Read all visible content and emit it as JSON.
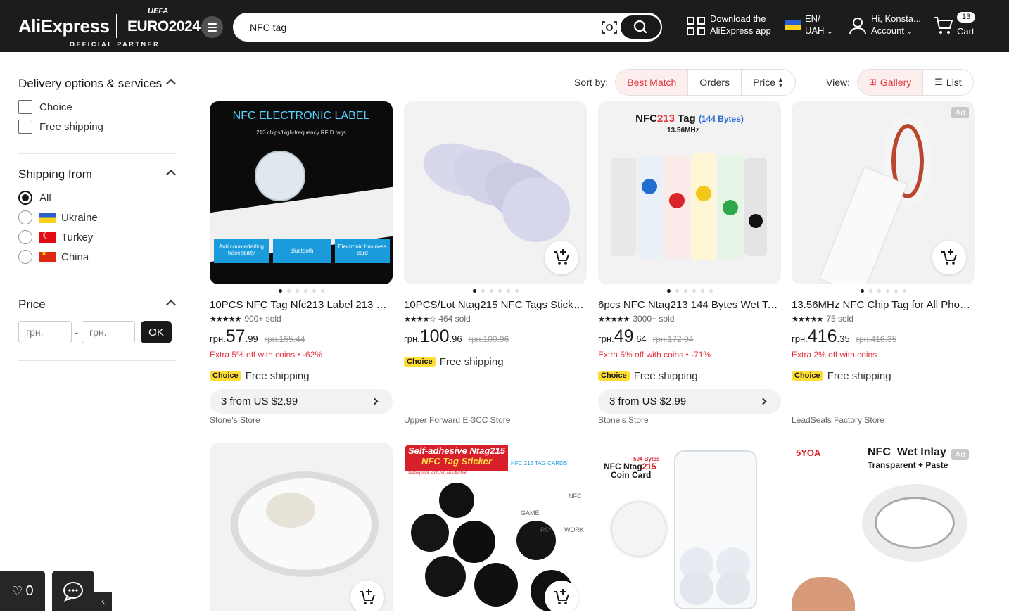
{
  "header": {
    "logo": "AliExpress",
    "euro_top": "UEFA",
    "euro": "EURO2024",
    "partner": "OFFICIAL PARTNER",
    "search_value": "NFC tag",
    "download_line1": "Download the",
    "download_line2": "AliExpress app",
    "lang_line1": "EN/",
    "lang_line2": "UAH",
    "account_line1": "Hi, Konsta...",
    "account_line2": "Account",
    "cart_count": "13",
    "cart_label": "Cart"
  },
  "sidebar": {
    "delivery_title": "Delivery options & services",
    "delivery_options": [
      "Choice",
      "Free shipping"
    ],
    "shipping_title": "Shipping from",
    "shipping_options": [
      "All",
      "Ukraine",
      "Turkey",
      "China"
    ],
    "price_title": "Price",
    "price_min_placeholder": "грн.",
    "price_max_placeholder": "грн.",
    "price_ok": "OK"
  },
  "sort": {
    "label": "Sort by:",
    "options": [
      "Best Match",
      "Orders",
      "Price"
    ],
    "active": "Best Match"
  },
  "view": {
    "label": "View:",
    "options": [
      "Gallery",
      "List"
    ],
    "active": "Gallery"
  },
  "products": [
    {
      "title": "10PCS NFC Tag Nfc213 Label 213 Sticker...",
      "sold": "900+ sold",
      "currency": "грн.",
      "price_int": "57",
      "price_dec": ".99",
      "old_price": "грн.155.44",
      "extra": "Extra 5% off with coins • -62%",
      "choice": "Choice",
      "shipping": "Free shipping",
      "bundle": "3 from US $2.99",
      "store": "Stone's Store",
      "img_title": "NFC ELECTRONIC LABEL",
      "img_sub": "213 chips/high-frequency RFID tags",
      "img_tags": [
        "Anti counterfeiting traceability",
        "bluetooth",
        "Electronic business card"
      ]
    },
    {
      "title": "10PCS/Lot Ntag215 NFC Tags Sticker P...",
      "sold": "464 sold",
      "currency": "грн.",
      "price_int": "100",
      "price_dec": ".96",
      "old_price": "грн.100.96",
      "choice": "Choice",
      "shipping": "Free shipping",
      "store": "Upper Forward E-3CC Store"
    },
    {
      "title": "6pcs NFC Ntag213 144 Bytes Wet Tag ...",
      "sold": "3000+ sold",
      "currency": "грн.",
      "price_int": "49",
      "price_dec": ".64",
      "old_price": "грн.172.94",
      "extra": "Extra 5% off with coins • -71%",
      "choice": "Choice",
      "shipping": "Free shipping",
      "bundle": "3 from US $2.99",
      "store": "Stone's Store",
      "img_title_a": "NFC",
      "img_title_b": "213",
      "img_title_c": " Tag ",
      "img_title_d": "(144 Bytes)",
      "img_sub": "13.56MHz"
    },
    {
      "title": "13.56MHz NFC Chip Tag for All Phone ...",
      "sold": "75 sold",
      "currency": "грн.",
      "price_int": "416",
      "price_dec": ".35",
      "old_price": "грн.416.35",
      "extra": "Extra 2% off with coins",
      "choice": "Choice",
      "shipping": "Free shipping",
      "store": "LeadSeals Factory Store",
      "ad": "Ad"
    }
  ],
  "row2": {
    "p6_banner1": "Self-adhesive Ntag215",
    "p6_banner2": "NFC Tag Sticker",
    "p6_banner3": "Waterproof, Anti-oil, Anti-friction",
    "p6_cards": "NFC 215 TAG CARDS",
    "p6_labels": [
      "GAME",
      "NFC",
      "PAY",
      "WORK"
    ],
    "p7_line1": "504 Bytes",
    "p7_line2a": "NFC Ntag",
    "p7_line2b": "215",
    "p7_line3": "Coin Card",
    "p8_brand": "5YOA",
    "p8_title": "NFC  Wet Inlay",
    "p8_sub": "Transparent + Paste",
    "p8_ad": "Ad"
  },
  "bottom": {
    "fav_count": "0"
  }
}
